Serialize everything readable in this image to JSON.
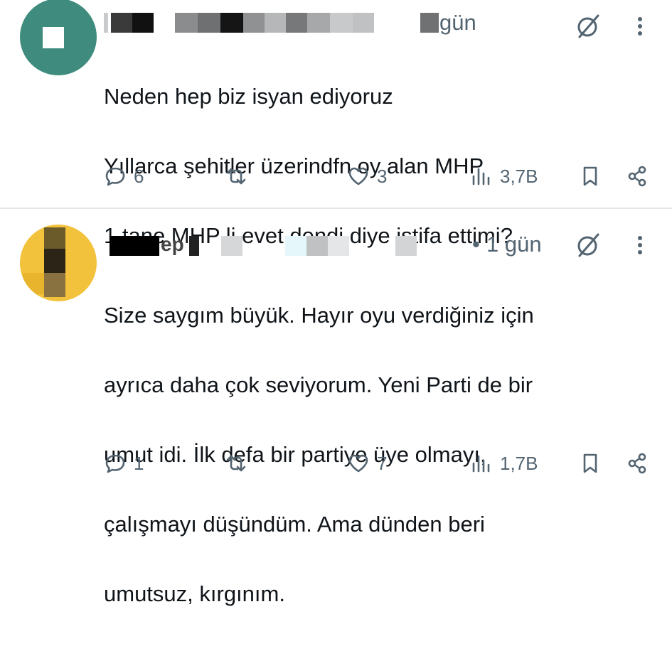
{
  "posts": [
    {
      "time": "gün",
      "text_lines": [
        "Neden hep biz isyan ediyoruz",
        "Yıllarca şehitler üzerindfn oy alan MHP",
        "1 tane MHP li evet dendi diye istifa ettimi?"
      ],
      "stats": {
        "replies": "6",
        "retweets": "",
        "likes": "3",
        "views": "3,7B"
      }
    },
    {
      "name_fragment": "ep",
      "time": "1 gün",
      "separator": "•",
      "text_lines": [
        "Size saygım büyük. Hayır oyu verdiğiniz için",
        "ayrıca daha çok seviyorum.  Yeni Parti de bir",
        "umut idi. İlk defa bir partiye üye olmayı,",
        "çalışmayı düşündüm. Ama dünden beri",
        "umutsuz, kırgınım."
      ],
      "stats": {
        "replies": "1",
        "retweets": "",
        "likes": "7",
        "views": "1,7B"
      }
    }
  ],
  "icons": [
    "reply-icon",
    "retweet-icon",
    "like-icon",
    "views-icon",
    "bookmark-icon",
    "share-icon",
    "grok-icon",
    "more-icon"
  ],
  "colors": {
    "text": "#0f1419",
    "muted": "#536471",
    "divider": "#e4e7ea",
    "avatar1": "#3f8c7e",
    "avatar2": "#f3c23c"
  }
}
